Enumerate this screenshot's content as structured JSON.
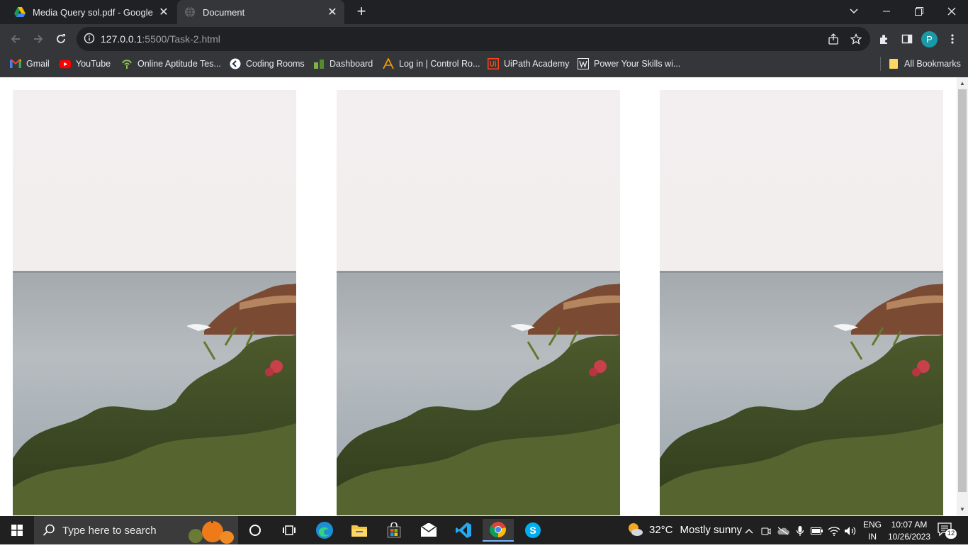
{
  "browser": {
    "tabs": [
      {
        "title": "Media Query sol.pdf - Google Dr",
        "icon": "google-drive-icon",
        "active": false
      },
      {
        "title": "Document",
        "icon": "globe-icon",
        "active": true
      }
    ],
    "url_host": "127.0.0.1",
    "url_rest": ":5500/Task-2.html",
    "profile_initial": "P",
    "bookmarks": [
      {
        "label": "Gmail",
        "icon": "gmail-icon"
      },
      {
        "label": "YouTube",
        "icon": "youtube-icon"
      },
      {
        "label": "Online Aptitude Tes...",
        "icon": "aptitude-icon"
      },
      {
        "label": "Coding Rooms",
        "icon": "coding-rooms-icon"
      },
      {
        "label": "Dashboard",
        "icon": "dashboard-icon"
      },
      {
        "label": "Log in | Control Ro...",
        "icon": "control-room-icon"
      },
      {
        "label": "UiPath Academy",
        "icon": "uipath-icon"
      },
      {
        "label": "Power Your Skills wi...",
        "icon": "wordpress-icon"
      }
    ],
    "all_bookmarks": "All Bookmarks"
  },
  "page": {
    "images": [
      "seaside-photo",
      "seaside-photo",
      "seaside-photo"
    ]
  },
  "taskbar": {
    "search_placeholder": "Type here to search",
    "weather_temp": "32°C",
    "weather_desc": "Mostly sunny",
    "lang_line1": "ENG",
    "lang_line2": "IN",
    "time": "10:07 AM",
    "date": "10/26/2023",
    "notification_count": "12"
  },
  "colors": {
    "tabstrip": "#202124",
    "toolbar": "#35363a",
    "accent_profile": "#1a9aa8",
    "taskbar": "#202020"
  }
}
